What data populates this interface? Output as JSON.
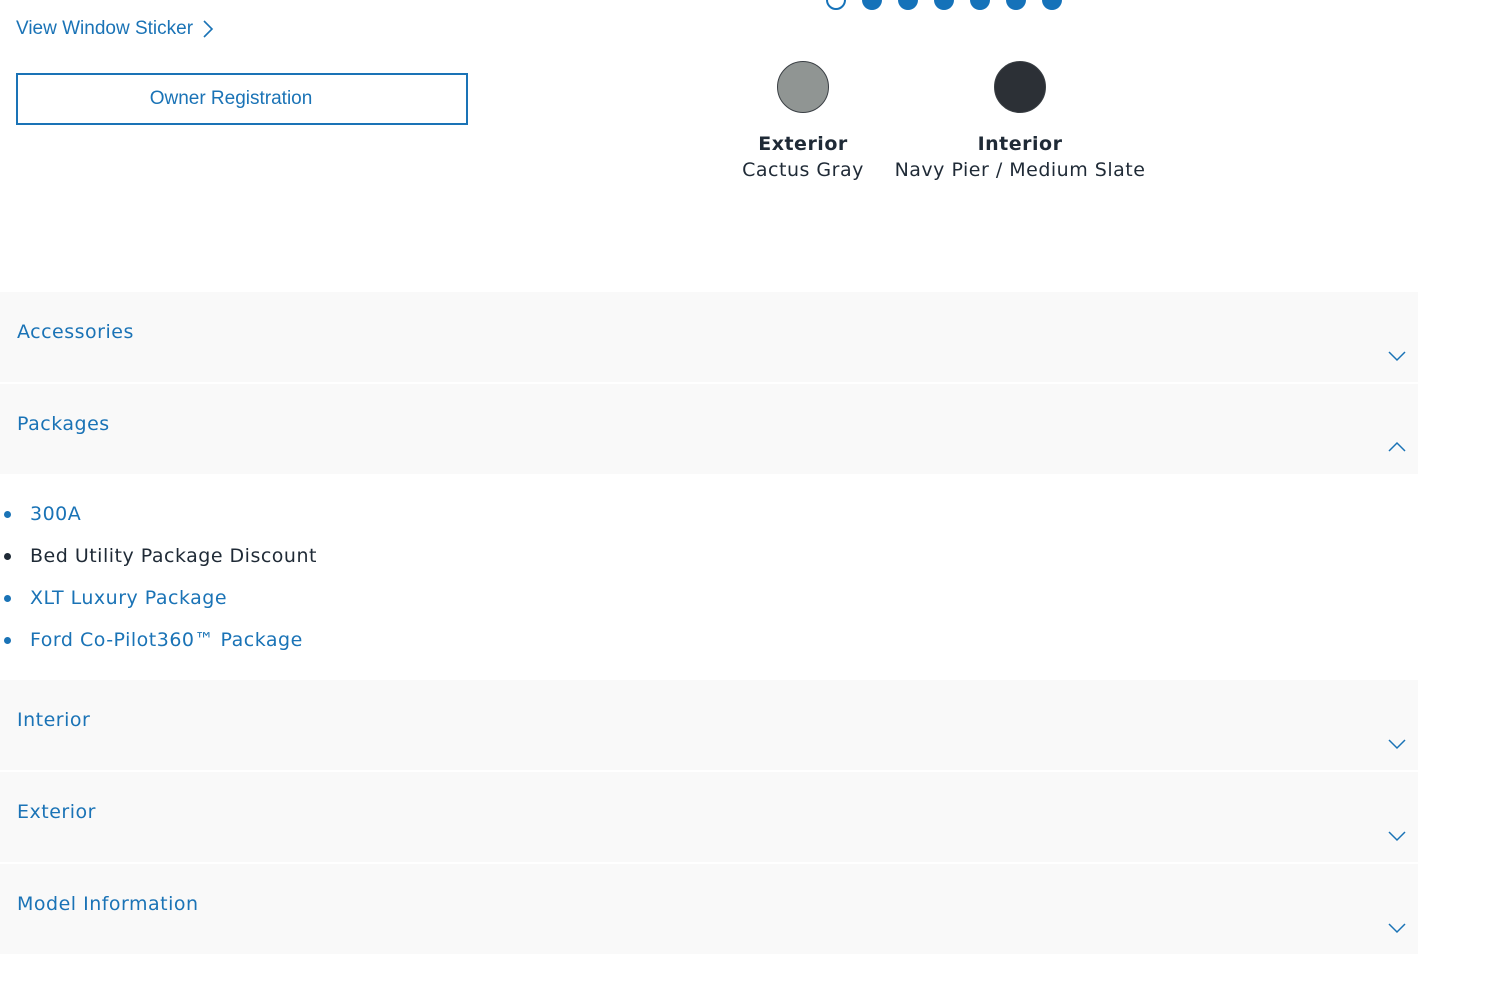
{
  "top_links": {
    "window_sticker": "View Window Sticker",
    "owner_registration": "Owner Registration"
  },
  "carousel": {
    "dot_count": 7,
    "active_index": 0
  },
  "colors": {
    "exterior": {
      "title": "Exterior",
      "value": "Cactus Gray",
      "swatch": "#909593"
    },
    "interior": {
      "title": "Interior",
      "value": "Navy Pier / Medium Slate",
      "swatch": "#2c3036"
    }
  },
  "sections": [
    {
      "label": "Accessories",
      "expanded": false
    },
    {
      "label": "Packages",
      "expanded": true
    },
    {
      "label": "Interior",
      "expanded": false
    },
    {
      "label": "Exterior",
      "expanded": false
    },
    {
      "label": "Model Information",
      "expanded": false
    }
  ],
  "packages": [
    {
      "label": "300A",
      "link": true
    },
    {
      "label": "Bed Utility Package Discount",
      "link": false
    },
    {
      "label": "XLT Luxury Package",
      "link": true
    },
    {
      "label": "Ford Co-Pilot360™ Package",
      "link": true
    }
  ],
  "theme": {
    "accent": "#1a73b6",
    "panel_bg": "#f9f9f9",
    "text": "#1f2a36"
  },
  "icons": {
    "link_chevron": "chevron-right-icon",
    "collapsed": "chevron-down-icon",
    "expanded": "chevron-up-icon"
  }
}
